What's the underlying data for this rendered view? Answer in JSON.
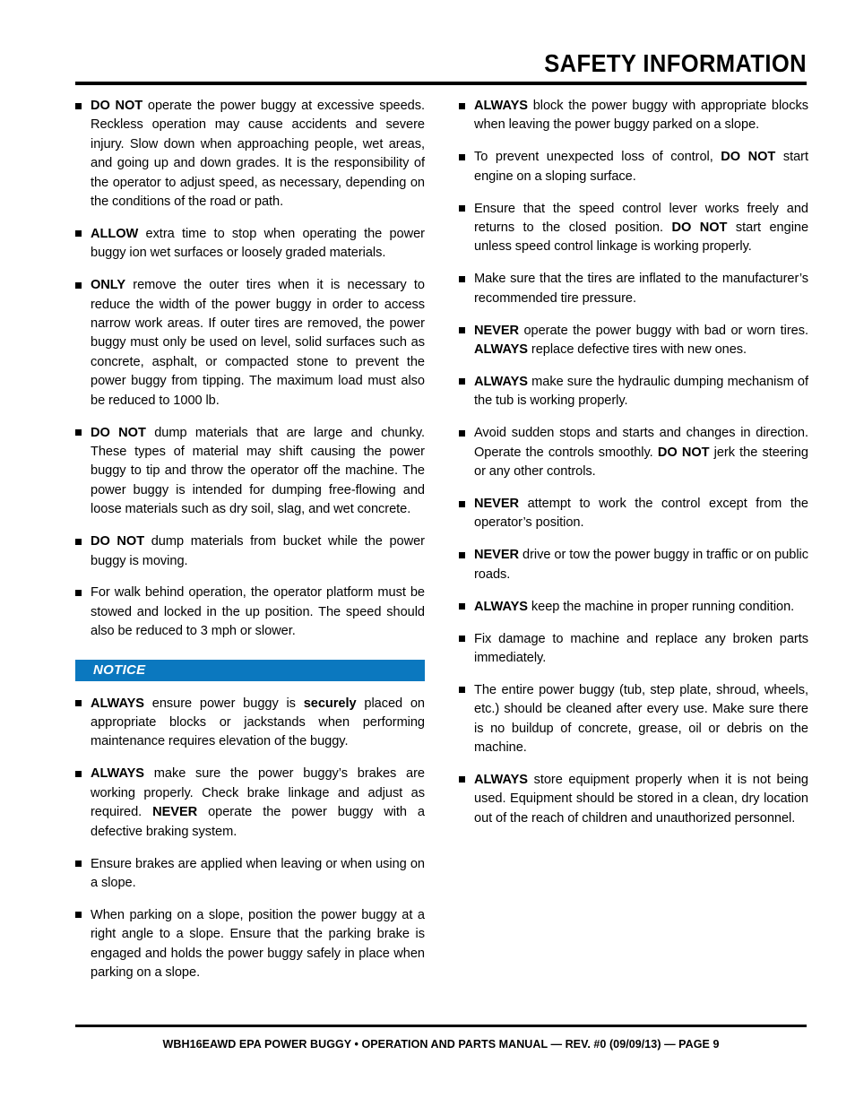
{
  "header": {
    "title": "SAFETY INFORMATION"
  },
  "notice": {
    "label": "NOTICE",
    "color": "#0b78bf"
  },
  "footer": {
    "text": "WBH16EAWD EPA POWER BUGGY • OPERATION AND PARTS MANUAL — REV. #0 (09/09/13) — PAGE 9"
  },
  "left_column": {
    "items_before_notice": [
      {
        "html": "<b>DO NOT</b> operate the power buggy at excessive speeds. Reckless operation may cause accidents and severe injury. Slow down when approaching people, wet areas, and going up and down grades. It is the responsibility of the operator to adjust speed, as necessary, depending on the conditions of the road or path."
      },
      {
        "html": "<b>ALLOW</b> extra time to stop when operating the power buggy ion wet surfaces or loosely graded materials."
      },
      {
        "html": "<b>ONLY</b> remove the outer tires when it is necessary to reduce the width of the power buggy in order to access narrow work areas. If outer tires are removed, the power buggy must only be used on level, solid surfaces such as concrete, asphalt, or compacted stone to prevent the power buggy from tipping. The maximum load must also be reduced to 1000 lb."
      },
      {
        "html": "<b>DO NOT</b> dump materials that are large and chunky. These types of material may shift causing the power buggy to tip and throw the operator off the machine. The power buggy is intended for dumping free-flowing and loose materials such as dry soil, slag, and wet concrete."
      },
      {
        "html": "<b>DO NOT</b> dump materials from bucket while the power buggy is moving."
      },
      {
        "html": "For walk behind operation, the operator platform must be stowed and locked in the up position. The speed should also be reduced to 3 mph or slower."
      }
    ],
    "items_after_notice": [
      {
        "html": "<b>ALWAYS</b> ensure power buggy is <b>securely</b> placed on appropriate blocks or jackstands when performing maintenance requires elevation of the buggy."
      },
      {
        "html": "<b>ALWAYS</b> make sure the power buggy&rsquo;s brakes are working properly. Check brake linkage and adjust as required. <b>NEVER</b> operate the power buggy with a defective braking system."
      },
      {
        "html": "Ensure brakes are applied when leaving or when using on a slope."
      },
      {
        "html": "When parking on a slope, position the power buggy at a right angle to a slope. Ensure that the parking brake is engaged and holds the power buggy safely in place when parking on a slope."
      }
    ]
  },
  "right_column": {
    "items": [
      {
        "html": "<b>ALWAYS</b> block the power buggy with appropriate blocks when leaving the power buggy parked on a slope."
      },
      {
        "html": "To prevent unexpected loss of control, <b>DO NOT</b> start engine on a sloping surface."
      },
      {
        "html": "Ensure that the speed control lever works freely and returns to the closed position. <b>DO NOT</b> start engine unless speed control linkage is working properly."
      },
      {
        "html": "Make sure that the tires are inflated to the manufacturer&rsquo;s recommended tire pressure."
      },
      {
        "html": "<b>NEVER</b> operate the power buggy with bad or worn tires. <b>ALWAYS</b> replace defective tires with new ones."
      },
      {
        "html": "<b>ALWAYS</b> make sure the hydraulic dumping mechanism of the tub is working properly."
      },
      {
        "html": "Avoid sudden stops and starts and changes in direction. Operate the controls smoothly. <b>DO NOT</b> jerk the steering or any other controls."
      },
      {
        "html": "<b>NEVER</b> attempt to work the control except from the operator&rsquo;s position."
      },
      {
        "html": "<b>NEVER</b> drive or tow the power buggy in traffic or on public roads."
      },
      {
        "html": "<b>ALWAYS</b> keep the machine in proper running condition."
      },
      {
        "html": "Fix damage to machine and replace any broken parts immediately."
      },
      {
        "html": "The entire power buggy (tub, step plate, shroud, wheels, etc.) should be cleaned after every use. Make sure there is no buildup of concrete, grease, oil or debris on the machine."
      },
      {
        "html": "<b>ALWAYS</b> store equipment properly when it is not being used. Equipment should be stored in a clean, dry location out of the reach of children and unauthorized personnel."
      }
    ]
  }
}
